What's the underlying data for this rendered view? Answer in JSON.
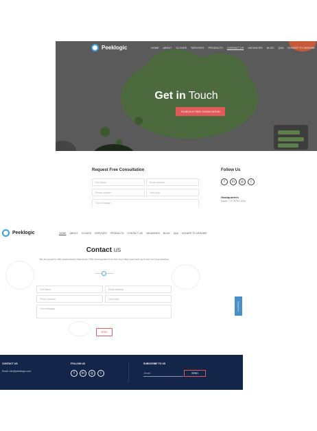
{
  "hero": {
    "brand": "Peeklogic",
    "nav": [
      "HOME",
      "ABOUT",
      "CLOUDS",
      "SERVICES",
      "PRODUCTS",
      "CONTACT US",
      "VACANCIES",
      "BLOG",
      "Q&A",
      "DONATE TO UKRAINE"
    ],
    "active_nav": "CONTACT US",
    "title_bold": "Get in",
    "title_light": "Touch",
    "cta_label": "SCHEDULE FREE CONSULTATION"
  },
  "consultation": {
    "title": "Request Free Consultation",
    "fields": {
      "fullname": "Full Name",
      "email": "Email address",
      "phone": "Phone number",
      "topic": "Your topic",
      "message": "Your message"
    }
  },
  "follow": {
    "title": "Follow Us",
    "icons": [
      "facebook-icon",
      "linkedin-icon",
      "instagram-icon",
      "twitter-icon"
    ],
    "hq_label": "Headquarters",
    "hq_address": "Austin, TX 78759, USA"
  },
  "contact_page": {
    "brand": "Peeklogic",
    "nav": [
      "HOME",
      "ABOUT",
      "CLOUDS",
      "SERVICES",
      "PRODUCTS",
      "CONTACT US",
      "VACANCIES",
      "BLOG",
      "Q&A",
      "DONATE TO UKRAINE"
    ],
    "active_nav": "HOME",
    "title_bold": "Contact",
    "title_light": "us",
    "subtitle": "We are proud to offer professional Salesforce CRM development from the very initial point and up to the end of production.",
    "fields": {
      "fullname": "Full Name",
      "email": "Email address",
      "phone": "Phone number",
      "topic": "Your topic",
      "message": "Your message"
    },
    "send_label": "SEND",
    "side_tab": "Contact Us"
  },
  "footer": {
    "contact_heading": "CONTACT US",
    "email_line": "Email:  info@peeklogic.com",
    "follow_heading": "FOLLOW US",
    "subscribe_heading": "SUBSCRIBE TO US",
    "email_placeholder": "Email",
    "send_label": "SEND"
  },
  "colors": {
    "accent": "#e05a5a",
    "footer_bg": "#14254a",
    "brand_blue": "#3aa0e0",
    "hero_bg": "#5a5a5a"
  }
}
